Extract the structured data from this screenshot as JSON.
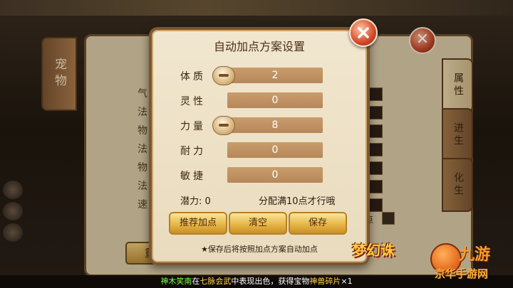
{
  "background": {
    "pet_tab": "宠物",
    "side_tabs": [
      "属性",
      "进生",
      "化生"
    ],
    "stat_labels": [
      "气",
      "法",
      "物",
      "法",
      "物",
      "法",
      "速"
    ],
    "auto_check_label": "点",
    "bottom_left_button": "重"
  },
  "dialog": {
    "title": "自动加点方案设置",
    "rows": [
      {
        "label": "体质",
        "value": "2",
        "has_minus": true
      },
      {
        "label": "灵性",
        "value": "0",
        "has_minus": false
      },
      {
        "label": "力量",
        "value": "8",
        "has_minus": true
      },
      {
        "label": "耐力",
        "value": "0",
        "has_minus": false
      },
      {
        "label": "敏捷",
        "value": "0",
        "has_minus": false
      }
    ],
    "potential_label": "潜力: 0",
    "rule_text": "分配满10点才行哦",
    "buttons": {
      "recommend": "推荐加点",
      "clear": "清空",
      "save": "保存"
    },
    "note": "★保存后将按照加点方案自动加点"
  },
  "news": {
    "name1": "神木笑南",
    "t1": "在",
    "place": "七脉会武",
    "t2": "中表现出色，获得宝物",
    "item": "神兽碎片",
    "count": "×1"
  },
  "logos": {
    "game": "梦幻诛",
    "site_big": "九游",
    "site_small": "京华手游网"
  },
  "colors": {
    "dialog_bg": "#f1e6cf",
    "value_box": "#c99c6c",
    "button_gold": "#e7b748",
    "close_red": "#d24a2c",
    "news_green": "#7cff4a",
    "news_yellow": "#ffd54a"
  }
}
